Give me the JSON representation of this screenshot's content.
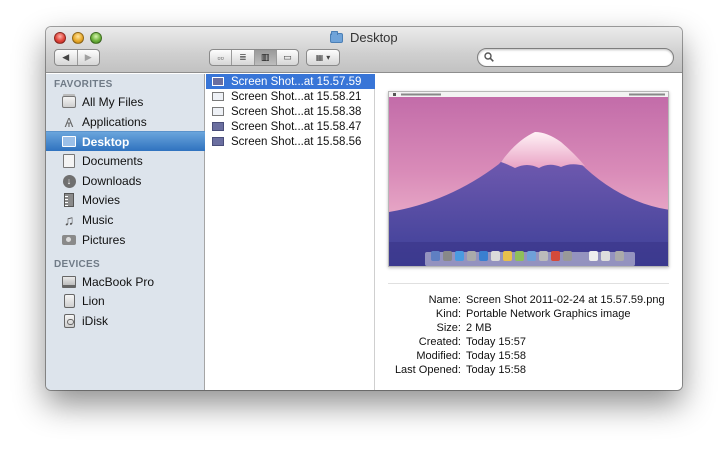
{
  "window": {
    "title": "Desktop"
  },
  "toolbar": {
    "back_glyph": "◀",
    "forward_glyph": "▶",
    "view_modes": [
      {
        "name": "icon-view",
        "glyph": "▫▫"
      },
      {
        "name": "list-view",
        "glyph": "≣"
      },
      {
        "name": "column-view",
        "glyph": "▥"
      },
      {
        "name": "coverflow-view",
        "glyph": "▭"
      }
    ],
    "arrange_glyph": "▦",
    "arrange_chevron": "▾",
    "search_placeholder": ""
  },
  "sidebar": {
    "favorites_header": "FAVORITES",
    "devices_header": "DEVICES",
    "favorites": [
      {
        "label": "All My Files",
        "icon": "all-files-icon"
      },
      {
        "label": "Applications",
        "icon": "applications-icon"
      },
      {
        "label": "Desktop",
        "icon": "desktop-icon",
        "selected": true
      },
      {
        "label": "Documents",
        "icon": "documents-icon"
      },
      {
        "label": "Downloads",
        "icon": "downloads-icon"
      },
      {
        "label": "Movies",
        "icon": "movies-icon"
      },
      {
        "label": "Music",
        "icon": "music-icon"
      },
      {
        "label": "Pictures",
        "icon": "pictures-icon"
      }
    ],
    "devices": [
      {
        "label": "MacBook Pro",
        "icon": "laptop-icon"
      },
      {
        "label": "Lion",
        "icon": "disk-icon"
      },
      {
        "label": "iDisk",
        "icon": "idisk-icon"
      }
    ]
  },
  "files": [
    {
      "label": "Screen Shot...at 15.57.59",
      "selected": true
    },
    {
      "label": "Screen Shot...at 15.58.21"
    },
    {
      "label": "Screen Shot...at 15.58.38"
    },
    {
      "label": "Screen Shot...at 15.58.47"
    },
    {
      "label": "Screen Shot...at 15.58.56"
    }
  ],
  "preview": {
    "meta": [
      {
        "label": "Name:",
        "value": "Screen Shot 2011-02-24 at 15.57.59.png"
      },
      {
        "label": "Kind:",
        "value": "Portable Network Graphics image"
      },
      {
        "label": "Size:",
        "value": "2 MB"
      },
      {
        "label": "Created:",
        "value": "Today 15:57"
      },
      {
        "label": "Modified:",
        "value": "Today 15:58"
      },
      {
        "label": "Last Opened:",
        "value": "Today 15:58"
      }
    ]
  },
  "colors": {
    "selection": "#3875d7",
    "sidebar_bg": "#dde4ec",
    "sidebar_selected": "#2f72bf"
  }
}
